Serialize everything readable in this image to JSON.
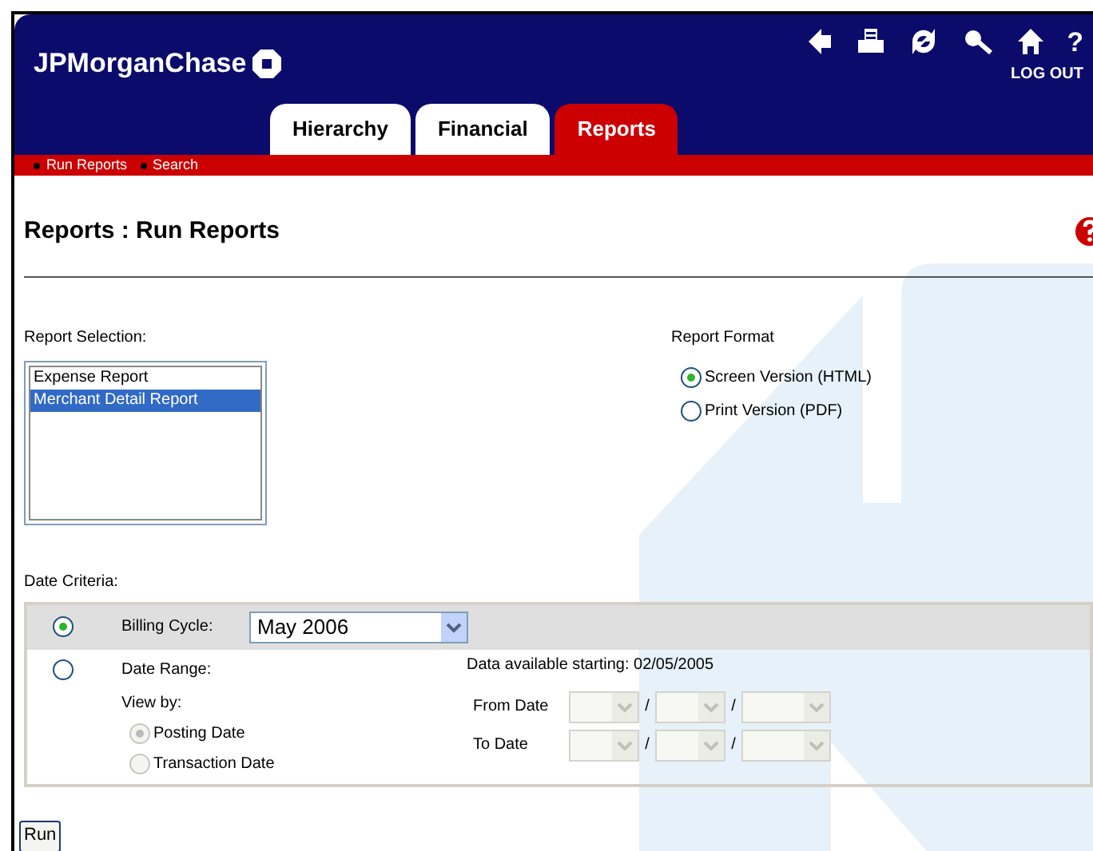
{
  "header": {
    "logo": "JPMorganChase",
    "toolbar": [
      {
        "kind": "back"
      },
      {
        "kind": "print"
      },
      {
        "kind": "refresh"
      },
      {
        "kind": "search"
      },
      {
        "kind": "home"
      },
      {
        "kind": "help",
        "label": "?"
      }
    ],
    "logout": "LOG OUT"
  },
  "tabs": [
    {
      "label": "Hierarchy",
      "selected": false
    },
    {
      "label": "Financial",
      "selected": false
    },
    {
      "label": "Reports",
      "selected": true
    }
  ],
  "subnav": [
    "Run Reports",
    "Search"
  ],
  "page_title": "Reports : Run Reports",
  "report_selection": {
    "label": "Report Selection:",
    "items": [
      {
        "label": "Expense Report",
        "selected": false
      },
      {
        "label": "Merchant Detail Report",
        "selected": true
      }
    ]
  },
  "report_format": {
    "label": "Report Format",
    "options": [
      {
        "label": "Screen Version (HTML)",
        "selected": true
      },
      {
        "label": "Print Version (PDF)",
        "selected": false
      }
    ]
  },
  "date_criteria": {
    "label": "Date Criteria:",
    "billing_cycle": {
      "label": "Billing Cycle:",
      "selected": true,
      "value": "May 2006"
    },
    "date_range": {
      "label": "Date Range:",
      "selected": false,
      "note": "Data available starting: 02/05/2005",
      "view_by": {
        "label": "View by:",
        "disabled": true,
        "options": [
          {
            "label": "Posting Date",
            "selected": true
          },
          {
            "label": "Transaction Date",
            "selected": false
          }
        ]
      },
      "dates": [
        {
          "label": "From Date",
          "separators": [
            "/",
            "/"
          ],
          "disabled": true
        },
        {
          "label": "To Date",
          "separators": [
            "/",
            "/"
          ],
          "disabled": true
        }
      ]
    }
  },
  "run_button": "Run"
}
